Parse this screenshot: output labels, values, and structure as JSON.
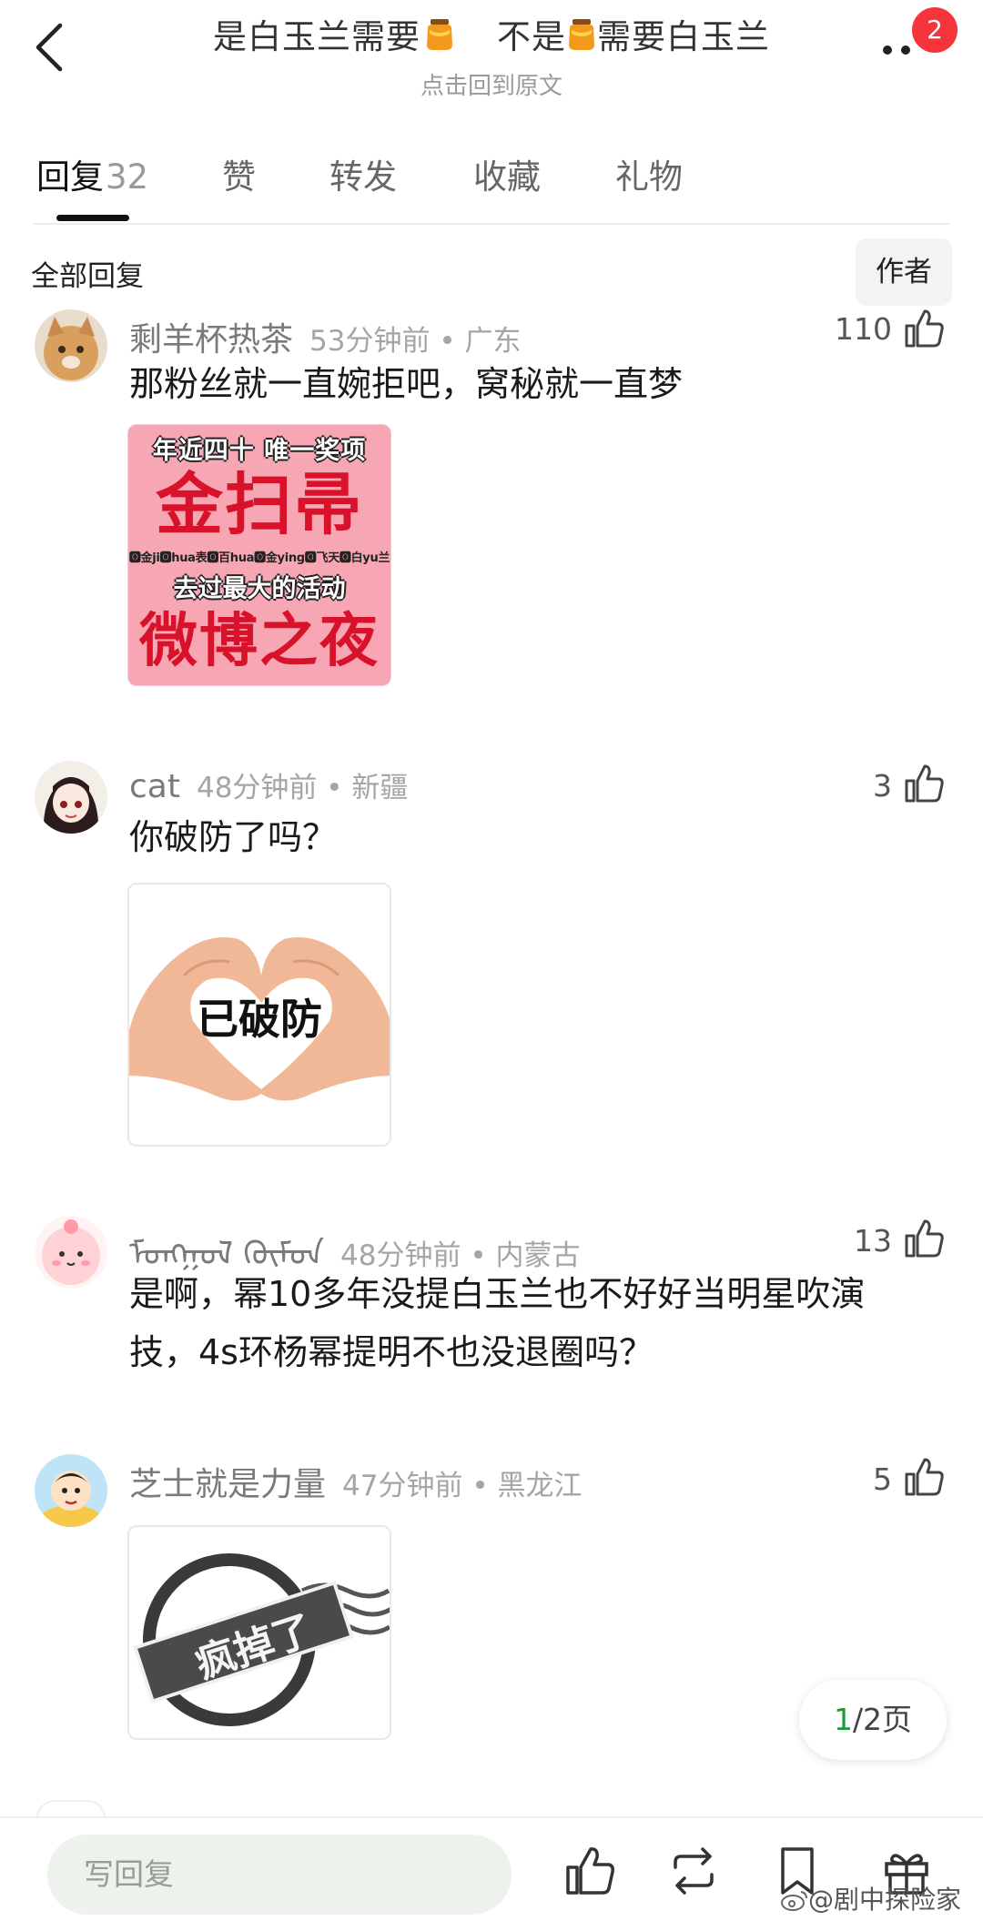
{
  "header": {
    "title_part1": "是白玉兰需要",
    "title_part2": "不是",
    "title_part3": "需要白玉兰",
    "subtitle": "点击回到原文",
    "notification_count": "2"
  },
  "tabs": [
    {
      "label": "回复",
      "count": "32",
      "active": true
    },
    {
      "label": "赞"
    },
    {
      "label": "转发"
    },
    {
      "label": "收藏"
    },
    {
      "label": "礼物"
    }
  ],
  "filter": {
    "label": "全部回复",
    "author_button": "作者"
  },
  "comments": [
    {
      "name": "剩羊杯热茶",
      "time_location": "53分钟前 • 广东",
      "likes": "110",
      "text": "那粉丝就一直婉拒吧，窝秘就一直梦",
      "image": {
        "line1": "年近四十 唯一奖项",
        "line2": "金扫帚",
        "line3": "🅾金ji🅾hua表🅾百hua🅾金ying🅾飞天🅾白yu兰",
        "line4": "去过最大的活动",
        "line5": "微博之夜"
      }
    },
    {
      "name": "cat",
      "time_location": "48分钟前 • 新疆",
      "likes": "3",
      "text": "你破防了吗？",
      "image": {
        "label": "已破防"
      }
    },
    {
      "name": "ᠮᠣᠩᠭᠣᠯ ᠬᠦᠮᠦᠨ",
      "time_location": "48分钟前 • 内蒙古",
      "likes": "13",
      "text_line1": "是啊，幂10多年没提白玉兰也不好好当明星吹演",
      "text_line2": "技，4s环杨幂提明不也没退圈吗？"
    },
    {
      "name": "芝士就是力量",
      "time_location": "47分钟前 • 黑龙江",
      "likes": "5",
      "image": {
        "label": "疯掉了"
      }
    }
  ],
  "pager": {
    "current": "1",
    "total": "/2页"
  },
  "bottom_bar": {
    "reply_placeholder": "写回复",
    "icons": [
      "like-icon",
      "repost-icon",
      "bookmark-icon",
      "gift-icon"
    ],
    "watermark": "@剧中探险家"
  },
  "colors": {
    "badge": "#f5343c",
    "pager_current": "#1a9c3a",
    "reply_input_bg": "#edf3ec",
    "meme_red": "#d8122a",
    "meme_pink": "#f7a7b4"
  }
}
